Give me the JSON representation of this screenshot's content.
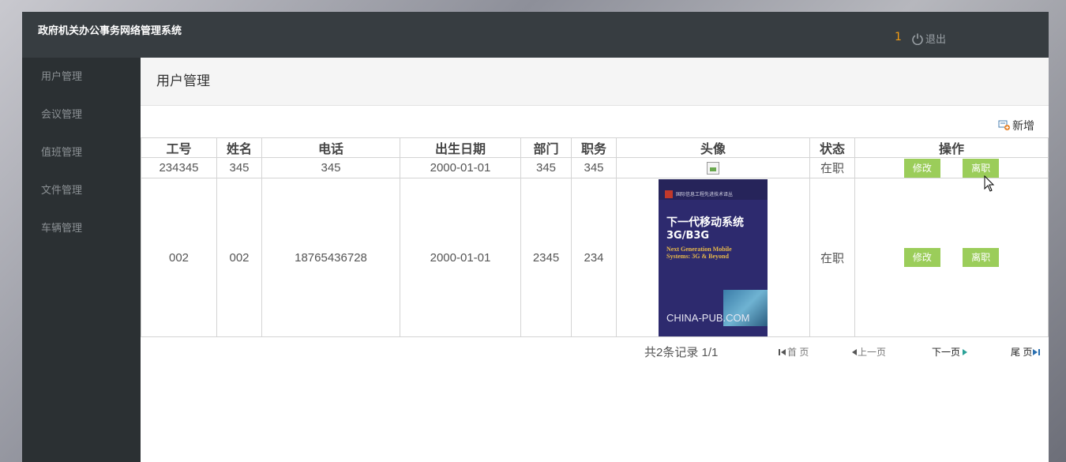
{
  "header": {
    "app_title": "政府机关办公事务网络管理系统",
    "user_count": "1",
    "logout_label": "退出"
  },
  "sidebar": {
    "items": [
      {
        "label": "用户管理"
      },
      {
        "label": "会议管理"
      },
      {
        "label": "值班管理"
      },
      {
        "label": "文件管理"
      },
      {
        "label": "车辆管理"
      }
    ]
  },
  "main": {
    "page_title": "用户管理",
    "add_label": "新增",
    "columns": [
      "工号",
      "姓名",
      "电话",
      "出生日期",
      "部门",
      "职务",
      "头像",
      "状态",
      "操作"
    ],
    "rows": [
      {
        "id": "234345",
        "name": "345",
        "phone": "345",
        "birth": "2000-01-01",
        "dept": "345",
        "position": "345",
        "status": "在职",
        "edit": "修改",
        "leave": "离职"
      },
      {
        "id": "002",
        "name": "002",
        "phone": "18765436728",
        "birth": "2000-01-01",
        "dept": "2345",
        "position": "234",
        "status": "在职",
        "edit": "修改",
        "leave": "离职"
      }
    ],
    "book_cover": {
      "series": "国际信息工程先进技术译丛",
      "title_cn": "下一代移动系统",
      "title_code": "3G/B3G",
      "title_en": "Next Generation Mobile Systems: 3G & Beyond",
      "publisher_mark": "CHINA-PUB.COM"
    }
  },
  "pager": {
    "summary": "共2条记录 1/1",
    "first": "首 页",
    "prev": "上一页",
    "next": "下一页",
    "last": "尾 页"
  },
  "colors": {
    "topbar": "#373d41",
    "sidebar": "#2b3033",
    "accent_orange": "#f39c12",
    "button_green": "#9bcd5a"
  }
}
